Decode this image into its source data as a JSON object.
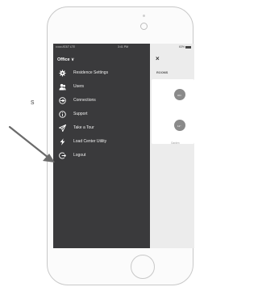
{
  "status_bar": {
    "carrier": "•••oo AT&T  LTE",
    "time": "3:41 PM",
    "battery": "63%"
  },
  "drawer": {
    "venue": "Office",
    "items": [
      {
        "label": "Residence Settings",
        "icon": "gear-icon"
      },
      {
        "label": "Users",
        "icon": "users-icon"
      },
      {
        "label": "Connections",
        "icon": "connections-icon"
      },
      {
        "label": "Support",
        "icon": "info-icon"
      },
      {
        "label": "Take a Tour",
        "icon": "tour-icon"
      },
      {
        "label": "Load Center Utility",
        "icon": "bolt-icon"
      },
      {
        "label": "Logout",
        "icon": "logout-icon"
      }
    ]
  },
  "background_app": {
    "close_symbol": "×",
    "section_label": "ROOMS",
    "rooms": [
      {
        "label": "ON"
      },
      {
        "label": "12\""
      }
    ],
    "room_subtitle": "Garden"
  },
  "annotation": {
    "text": "s"
  },
  "colors": {
    "drawer_bg": "#3a3a3c",
    "arrow": "#6b6b6b"
  }
}
